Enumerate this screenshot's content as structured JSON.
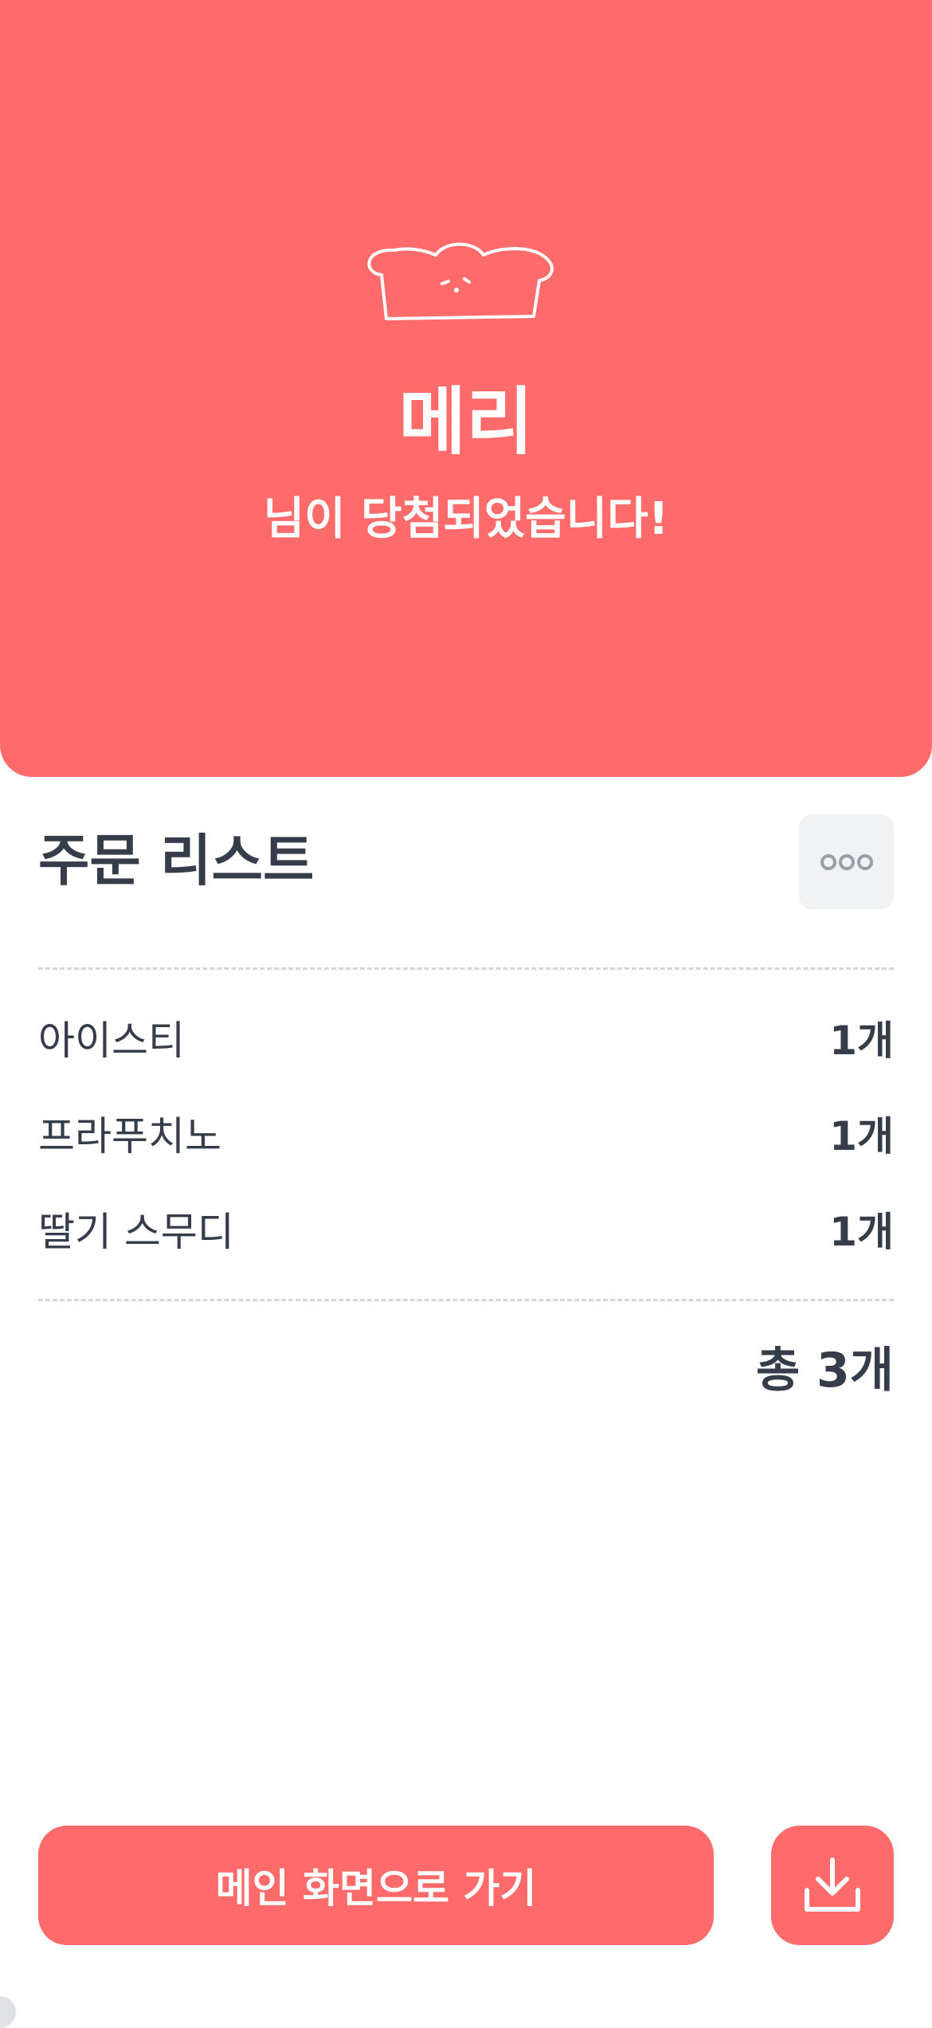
{
  "hero": {
    "winner_name": "메리",
    "winner_message": "님이 당첨되었습니다!",
    "icon": "bread-face-icon"
  },
  "order_list": {
    "title": "주문 리스트",
    "more_icon": "more-dots-icon",
    "items": [
      {
        "name": "아이스티",
        "qty": "1개"
      },
      {
        "name": "프라푸치노",
        "qty": "1개"
      },
      {
        "name": "딸기 스무디",
        "qty": "1개"
      }
    ],
    "total": "총 3개"
  },
  "actions": {
    "main_button_label": "메인 화면으로 가기",
    "download_icon": "download-icon"
  },
  "colors": {
    "accent": "#ff6b6b",
    "text": "#353d4a",
    "muted_bg": "#f1f2f4",
    "divider": "#d3d6db"
  }
}
